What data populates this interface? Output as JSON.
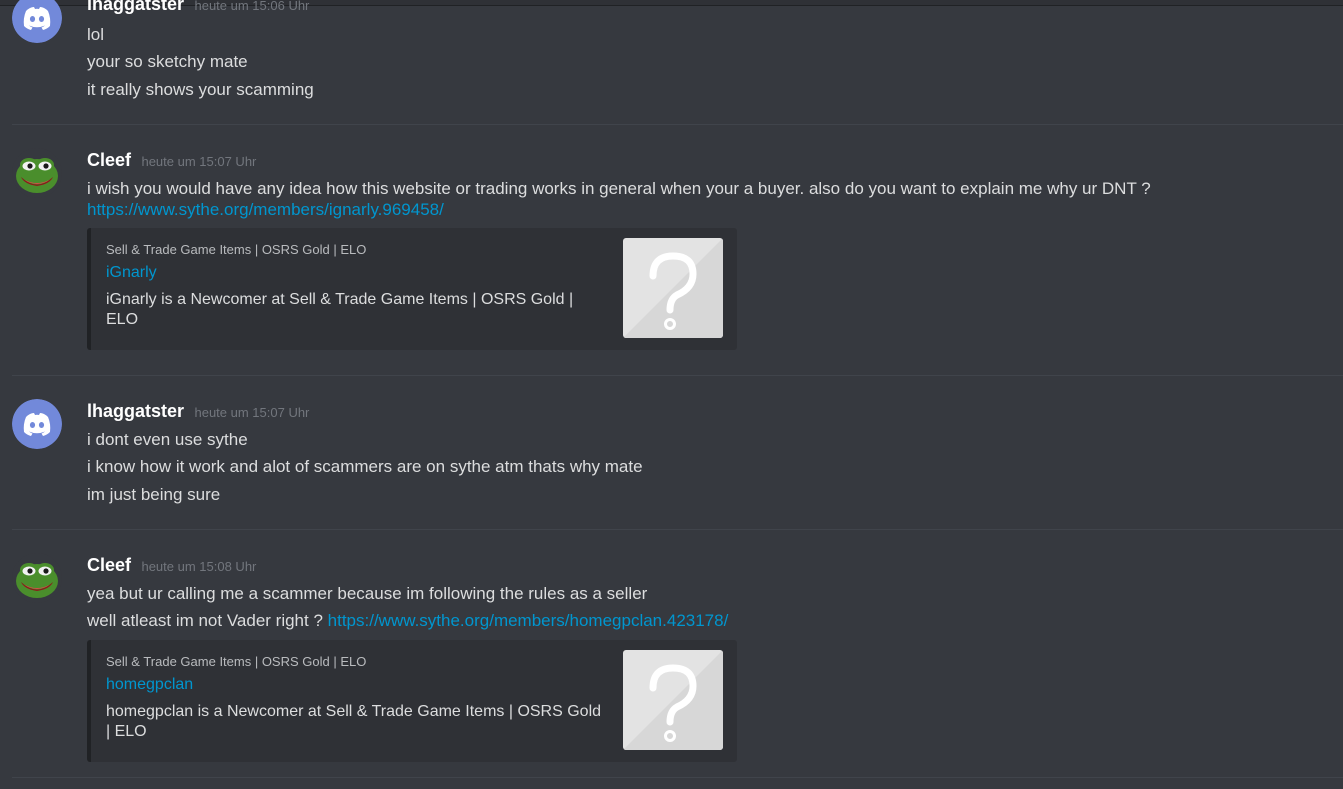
{
  "colors": {
    "background": "#36393f",
    "text": "#dcddde",
    "username": "#ffffff",
    "timestamp": "#72767d",
    "link": "#0096cf",
    "embed_bg": "#2f3136",
    "discord_blurple": "#7289da",
    "pepe_green": "#4a8e2c"
  },
  "groups": [
    {
      "avatar": "discord-default-avatar-icon",
      "author": "lhaggatster",
      "timestamp": "heute um 15:06 Uhr",
      "lines": [
        "lol",
        "your so sketchy mate",
        "it really shows your scamming"
      ]
    },
    {
      "avatar": "pepe-avatar-icon",
      "author": "Cleef",
      "timestamp": "heute um 15:07 Uhr",
      "lines": [
        "i wish you would have any idea how this website or trading works in general when your a buyer. also do you want to explain me why ur DNT ?"
      ],
      "link": "https://www.sythe.org/members/ignarly.969458/",
      "embed": {
        "provider": "Sell & Trade Game Items | OSRS Gold | ELO",
        "title": "iGnarly",
        "description": "iGnarly is a Newcomer at Sell & Trade Game Items | OSRS Gold | ELO",
        "thumbnail": "question-mark-icon"
      }
    },
    {
      "avatar": "discord-default-avatar-icon",
      "author": "lhaggatster",
      "timestamp": "heute um 15:07 Uhr",
      "lines": [
        "i dont even use sythe",
        "i know how it work and alot of scammers are on sythe atm thats why mate",
        "im just being sure"
      ]
    },
    {
      "avatar": "pepe-avatar-icon",
      "author": "Cleef",
      "timestamp": "heute um 15:08 Uhr",
      "lines": [
        "yea but ur calling me a scammer because im following the rules as a seller"
      ],
      "line2_text": "well atleast im not Vader right ?",
      "link": "https://www.sythe.org/members/homegpclan.423178/",
      "embed": {
        "provider": "Sell & Trade Game Items | OSRS Gold | ELO",
        "title": "homegpclan",
        "description": "homegpclan is a Newcomer at Sell & Trade Game Items | OSRS Gold | ELO",
        "thumbnail": "question-mark-icon"
      }
    }
  ]
}
